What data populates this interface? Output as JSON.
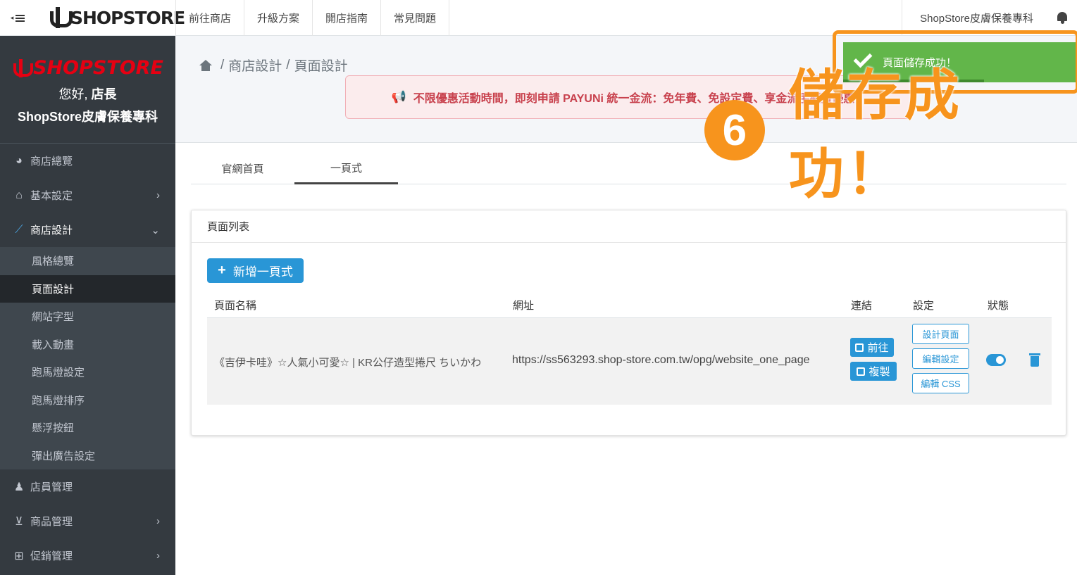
{
  "topbar": {
    "logo_text": "SHOPSTORE",
    "nav": [
      "前往商店",
      "升級方案",
      "開店指南",
      "常見問題"
    ],
    "store_name": "ShopStore皮膚保養專科"
  },
  "sidebar": {
    "brand_logo": "SHOPSTORE",
    "greeting": "您好,",
    "user_role": "店長",
    "store_name": "ShopStore皮膚保養專科",
    "menu": {
      "overview": "商店總覽",
      "basic": "基本設定",
      "design": "商店設計",
      "staff": "店員管理",
      "products": "商品管理",
      "promo": "促銷管理"
    },
    "submenu": [
      "風格總覽",
      "頁面設計",
      "網站字型",
      "載入動畫",
      "跑馬燈設定",
      "跑馬燈排序",
      "懸浮按鈕",
      "彈出廣告設定"
    ]
  },
  "breadcrumb": {
    "level1": "商店設計",
    "level2": "頁面設計"
  },
  "promo_text": "不限優惠活動時間，即刻申請 PAYUNi 統一金流：免年費、免設定費、享金流手續費優惠！",
  "tabs": [
    "官網首頁",
    "一頁式"
  ],
  "card": {
    "title": "頁面列表",
    "add_button": "新增一頁式",
    "columns": {
      "name": "頁面名稱",
      "url": "網址",
      "link": "連結",
      "settings": "設定",
      "status": "狀態"
    },
    "row": {
      "name": "《吉伊卡哇》☆人氣小可愛☆ | KR公仔造型捲尺 ちいかわ",
      "url": "https://ss563293.shop-store.com.tw/opg/website_one_page",
      "goto": "前往",
      "copy": "複製",
      "design_page": "設計頁面",
      "edit_settings": "編輯設定",
      "edit_css": "編輯 CSS",
      "status_on": true
    }
  },
  "toast": {
    "message": "頁面儲存成功！"
  },
  "annotation": {
    "number": "6",
    "text": "儲存成功！"
  },
  "colors": {
    "accent": "#2996d6",
    "sidebar_bg": "#343a40",
    "toast_green": "#62b64a",
    "annotation_orange": "#f7941d",
    "brand_red": "#e60012"
  }
}
